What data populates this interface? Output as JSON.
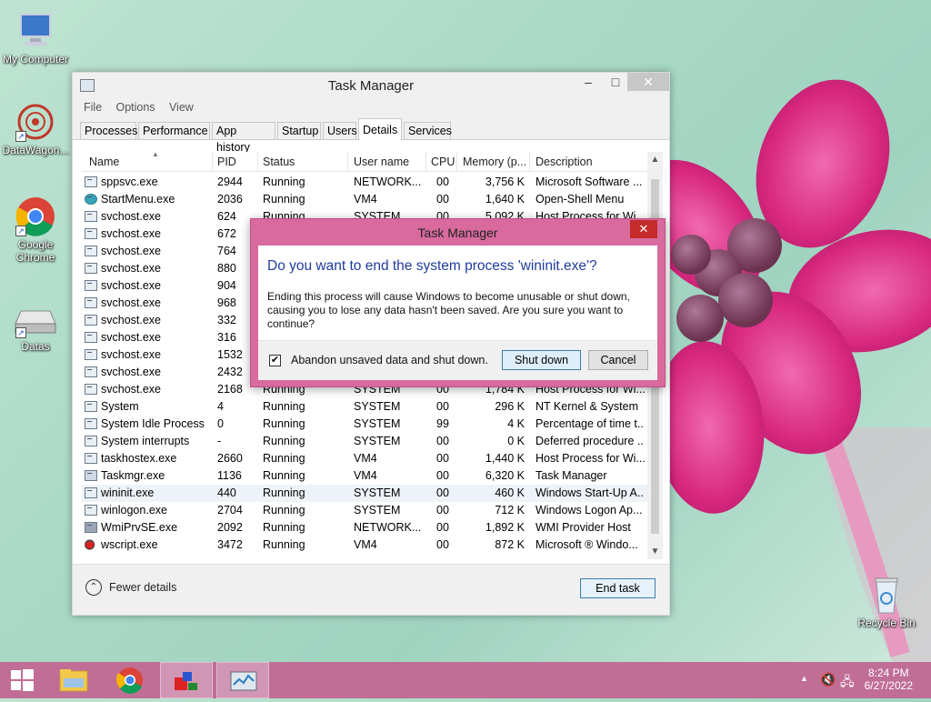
{
  "desktop": {
    "icons": [
      {
        "label": "My Computer"
      },
      {
        "label": "DataWagon..."
      },
      {
        "label": "Google Chrome"
      },
      {
        "label": "Datas"
      },
      {
        "label": "Recycle Bin"
      }
    ]
  },
  "window": {
    "title": "Task Manager",
    "minimize": "–",
    "maximize": "□",
    "close": "✕"
  },
  "menu": [
    "File",
    "Options",
    "View"
  ],
  "tabs": [
    "Processes",
    "Performance",
    "App history",
    "Startup",
    "Users",
    "Details",
    "Services"
  ],
  "active_tab": "Details",
  "columns": [
    "Name",
    "PID",
    "Status",
    "User name",
    "CPU",
    "Memory (p...",
    "Description"
  ],
  "rows": [
    {
      "name": "sppsvc.exe",
      "pid": "2944",
      "status": "Running",
      "user": "NETWORK...",
      "cpu": "00",
      "mem": "3,756 K",
      "desc": "Microsoft Software ..."
    },
    {
      "name": "StartMenu.exe",
      "pid": "2036",
      "status": "Running",
      "user": "VM4",
      "cpu": "00",
      "mem": "1,640 K",
      "desc": "Open-Shell Menu"
    },
    {
      "name": "svchost.exe",
      "pid": "624",
      "status": "Running",
      "user": "SYSTEM",
      "cpu": "00",
      "mem": "5,092 K",
      "desc": "Host Process for Wi..."
    },
    {
      "name": "svchost.exe",
      "pid": "672",
      "status": "",
      "user": "",
      "cpu": "",
      "mem": "",
      "desc": ""
    },
    {
      "name": "svchost.exe",
      "pid": "764",
      "status": "",
      "user": "",
      "cpu": "",
      "mem": "",
      "desc": ""
    },
    {
      "name": "svchost.exe",
      "pid": "880",
      "status": "",
      "user": "",
      "cpu": "",
      "mem": "",
      "desc": ""
    },
    {
      "name": "svchost.exe",
      "pid": "904",
      "status": "",
      "user": "",
      "cpu": "",
      "mem": "",
      "desc": ""
    },
    {
      "name": "svchost.exe",
      "pid": "968",
      "status": "",
      "user": "",
      "cpu": "",
      "mem": "",
      "desc": ""
    },
    {
      "name": "svchost.exe",
      "pid": "332",
      "status": "",
      "user": "",
      "cpu": "",
      "mem": "",
      "desc": ""
    },
    {
      "name": "svchost.exe",
      "pid": "316",
      "status": "",
      "user": "",
      "cpu": "",
      "mem": "",
      "desc": ""
    },
    {
      "name": "svchost.exe",
      "pid": "1532",
      "status": "",
      "user": "",
      "cpu": "",
      "mem": "",
      "desc": ""
    },
    {
      "name": "svchost.exe",
      "pid": "2432",
      "status": "",
      "user": "",
      "cpu": "",
      "mem": "",
      "desc": ""
    },
    {
      "name": "svchost.exe",
      "pid": "2168",
      "status": "Running",
      "user": "SYSTEM",
      "cpu": "00",
      "mem": "1,784 K",
      "desc": "Host Process for Wi..."
    },
    {
      "name": "System",
      "pid": "4",
      "status": "Running",
      "user": "SYSTEM",
      "cpu": "00",
      "mem": "296 K",
      "desc": "NT Kernel & System"
    },
    {
      "name": "System Idle Process",
      "pid": "0",
      "status": "Running",
      "user": "SYSTEM",
      "cpu": "99",
      "mem": "4 K",
      "desc": "Percentage of time t..."
    },
    {
      "name": "System interrupts",
      "pid": "-",
      "status": "Running",
      "user": "SYSTEM",
      "cpu": "00",
      "mem": "0 K",
      "desc": "Deferred procedure ..."
    },
    {
      "name": "taskhostex.exe",
      "pid": "2660",
      "status": "Running",
      "user": "VM4",
      "cpu": "00",
      "mem": "1,440 K",
      "desc": "Host Process for Wi..."
    },
    {
      "name": "Taskmgr.exe",
      "pid": "1136",
      "status": "Running",
      "user": "VM4",
      "cpu": "00",
      "mem": "6,320 K",
      "desc": "Task Manager"
    },
    {
      "name": "wininit.exe",
      "pid": "440",
      "status": "Running",
      "user": "SYSTEM",
      "cpu": "00",
      "mem": "460 K",
      "desc": "Windows Start-Up A..."
    },
    {
      "name": "winlogon.exe",
      "pid": "2704",
      "status": "Running",
      "user": "SYSTEM",
      "cpu": "00",
      "mem": "712 K",
      "desc": "Windows Logon Ap..."
    },
    {
      "name": "WmiPrvSE.exe",
      "pid": "2092",
      "status": "Running",
      "user": "NETWORK...",
      "cpu": "00",
      "mem": "1,892 K",
      "desc": "WMI Provider Host"
    },
    {
      "name": "wscript.exe",
      "pid": "3472",
      "status": "Running",
      "user": "VM4",
      "cpu": "00",
      "mem": "872 K",
      "desc": "Microsoft ® Windo..."
    }
  ],
  "footer": {
    "fewer_details": "Fewer details",
    "end_task": "End task"
  },
  "dialog": {
    "title": "Task Manager",
    "close": "✕",
    "heading": "Do you want to end the system process 'wininit.exe'?",
    "message": "Ending this process will cause Windows to become unusable or shut down, causing you to lose any data hasn't been saved. Are you sure you want to continue?",
    "checkbox_label": "Abandon unsaved data and shut down.",
    "checkbox_checked": true,
    "primary_button": "Shut down",
    "cancel_button": "Cancel"
  },
  "taskbar": {
    "time": "8:24 PM",
    "date": "6/27/2022"
  }
}
